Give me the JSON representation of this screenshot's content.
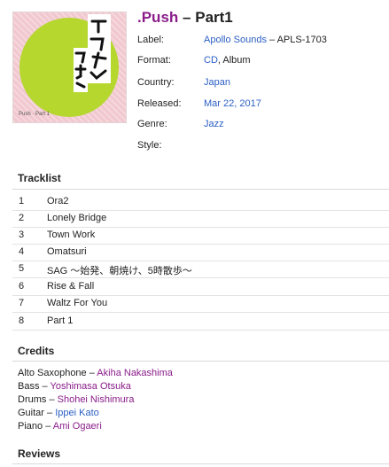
{
  "release": {
    "artist": ".Push",
    "separator": "–",
    "title": "Part1"
  },
  "cover": {
    "caption": "Push · Part 1",
    "bg_color": "#f1c8cf",
    "circle_color": "#b5d72e"
  },
  "info": {
    "label": {
      "key": "Label:",
      "link": "Apollo Sounds",
      "suffix": "– APLS-1703"
    },
    "format": {
      "key": "Format:",
      "link": "CD",
      "suffix": ", Album"
    },
    "country": {
      "key": "Country:",
      "link": "Japan"
    },
    "released": {
      "key": "Released:",
      "link": "Mar 22, 2017"
    },
    "genre": {
      "key": "Genre:",
      "link": "Jazz"
    },
    "style": {
      "key": "Style:"
    }
  },
  "tracklist": {
    "heading": "Tracklist",
    "tracks": [
      {
        "pos": "1",
        "title": "Ora2"
      },
      {
        "pos": "2",
        "title": "Lonely Bridge"
      },
      {
        "pos": "3",
        "title": "Town Work"
      },
      {
        "pos": "4",
        "title": "Omatsuri"
      },
      {
        "pos": "5",
        "title": "SAG 〜始発、朝焼け、5時散歩〜"
      },
      {
        "pos": "6",
        "title": "Rise & Fall"
      },
      {
        "pos": "7",
        "title": "Waltz For You"
      },
      {
        "pos": "8",
        "title": "Part 1"
      }
    ]
  },
  "credits": {
    "heading": "Credits",
    "items": [
      {
        "role": "Alto Saxophone",
        "name": "Akiha Nakashima"
      },
      {
        "role": "Bass",
        "name": "Yoshimasa Otsuka"
      },
      {
        "role": "Drums",
        "name": "Shohei Nishimura"
      },
      {
        "role": "Guitar",
        "name": "Ippei Kato"
      },
      {
        "role": "Piano",
        "name": "Ami Ogaeri"
      }
    ]
  },
  "reviews": {
    "heading": "Reviews"
  }
}
